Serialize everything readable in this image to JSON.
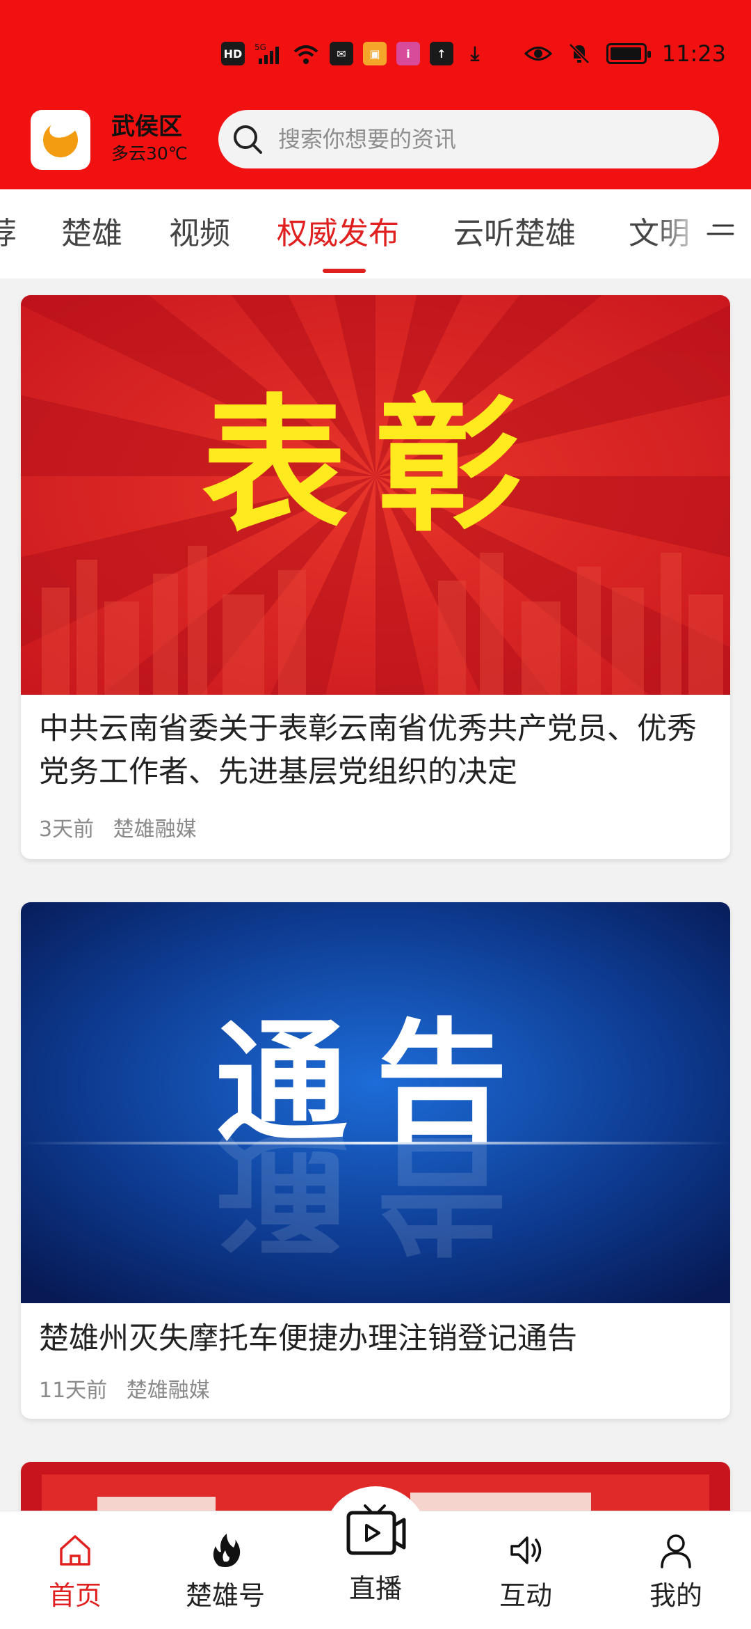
{
  "status_bar": {
    "time": "11:23",
    "left_icons": [
      "HD",
      "5G",
      "wifi-icon",
      "mail-icon",
      "app-icon",
      "app-icon",
      "upload-icon",
      "download-icon"
    ]
  },
  "header": {
    "location_name": "武侯区",
    "weather": "多云30℃",
    "search_placeholder": "搜索你想要的资讯"
  },
  "tabs": {
    "items": [
      {
        "label": "荐"
      },
      {
        "label": "楚雄"
      },
      {
        "label": "视频"
      },
      {
        "label": "权威发布"
      },
      {
        "label": "云听楚雄"
      },
      {
        "label": "文明"
      }
    ],
    "active_index": 3
  },
  "feed": {
    "cards": [
      {
        "banner_text": "表彰",
        "title": "中共云南省委关于表彰云南省优秀共产党员、优秀党务工作者、先进基层党组织的决定",
        "time": "3天前",
        "source": "楚雄融媒"
      },
      {
        "banner_text": "通告",
        "title": "楚雄州灭失摩托车便捷办理注销登记通告",
        "time": "11天前",
        "source": "楚雄融媒"
      }
    ]
  },
  "bottom_nav": {
    "items": [
      {
        "label": "首页",
        "icon": "home-icon"
      },
      {
        "label": "楚雄号",
        "icon": "fire-icon"
      },
      {
        "label": "直播",
        "icon": "live-tv-icon"
      },
      {
        "label": "互动",
        "icon": "speaker-icon"
      },
      {
        "label": "我的",
        "icon": "user-icon"
      }
    ],
    "active_index": 0
  },
  "colors": {
    "brand_red": "#f21111",
    "active_red": "#e0201f",
    "banner_blue": "#0d3a8f",
    "banner_yellow": "#ffea1f"
  }
}
